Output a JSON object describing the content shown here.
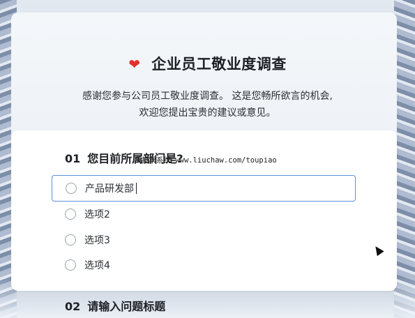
{
  "survey": {
    "icon": "heart-icon",
    "title": "企业员工敬业度调查",
    "description_line1": "感谢您参与公司员工敬业度调查。 这是您畅所欲言的机会,",
    "description_line2": "欢迎您提出宝贵的建议或意见。"
  },
  "question1": {
    "number": "01",
    "title": "您目前所属部门是?",
    "overlay_text": "投票系统 www.liuchaw.com/toupiao",
    "options": [
      {
        "label": "产品研发部",
        "editing": true
      },
      {
        "label": "选项2"
      },
      {
        "label": "选项3"
      },
      {
        "label": "选项4"
      }
    ]
  },
  "question2": {
    "number": "02",
    "title": "请输入问题标题"
  },
  "colors": {
    "accent_border": "#5b8ddb",
    "heart": "#e3312d"
  }
}
